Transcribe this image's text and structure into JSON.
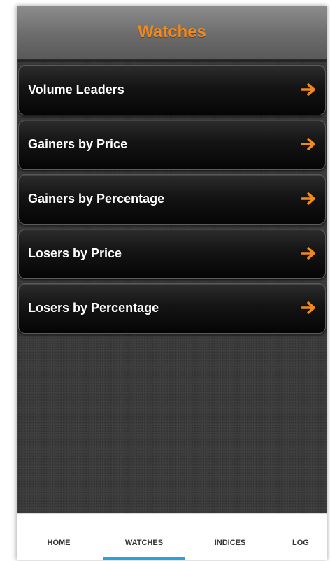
{
  "header": {
    "title": "Watches"
  },
  "menu": {
    "items": [
      {
        "label": "Volume Leaders"
      },
      {
        "label": "Gainers by Price"
      },
      {
        "label": "Gainers by Percentage"
      },
      {
        "label": "Losers by Price"
      },
      {
        "label": "Losers by Percentage"
      }
    ],
    "arrow_icon": "arrow-right-icon"
  },
  "tabs": {
    "items": [
      {
        "label": "HOME"
      },
      {
        "label": "WATCHES"
      },
      {
        "label": "INDICES"
      },
      {
        "label": "LOG"
      }
    ],
    "selected": "WATCHES"
  },
  "colors": {
    "accent_orange": "#f2891a",
    "tab_indicator_blue": "#29a3dc",
    "background": "#3a3a3a"
  }
}
